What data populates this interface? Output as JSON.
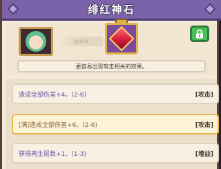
{
  "header": {
    "title": "绯红神石"
  },
  "top": {
    "portrait_icon": "character-portrait",
    "arrows_text": "<<<",
    "gem_icon": "crimson-gem",
    "lock_icon": "lock-icon",
    "description": "更容易出现攻击相关的效果。"
  },
  "affixes": [
    {
      "text": "造成全部伤害+4。(2-6)",
      "tag": "[攻击]",
      "highlighted": false
    },
    {
      "text": "[满]造成全部伤害+6。(2-6)",
      "tag": "[攻击]",
      "highlighted": true
    },
    {
      "text": "获得再生层数+1。(1-3)",
      "tag": "[增益]",
      "highlighted": false
    }
  ],
  "colors": {
    "title_bar": "#7a63a8",
    "affix_text": "#6b55a8",
    "highlight_border": "#e6b84f",
    "lock_green": "#4bbf5a",
    "gem_red": "#d61c3a"
  }
}
